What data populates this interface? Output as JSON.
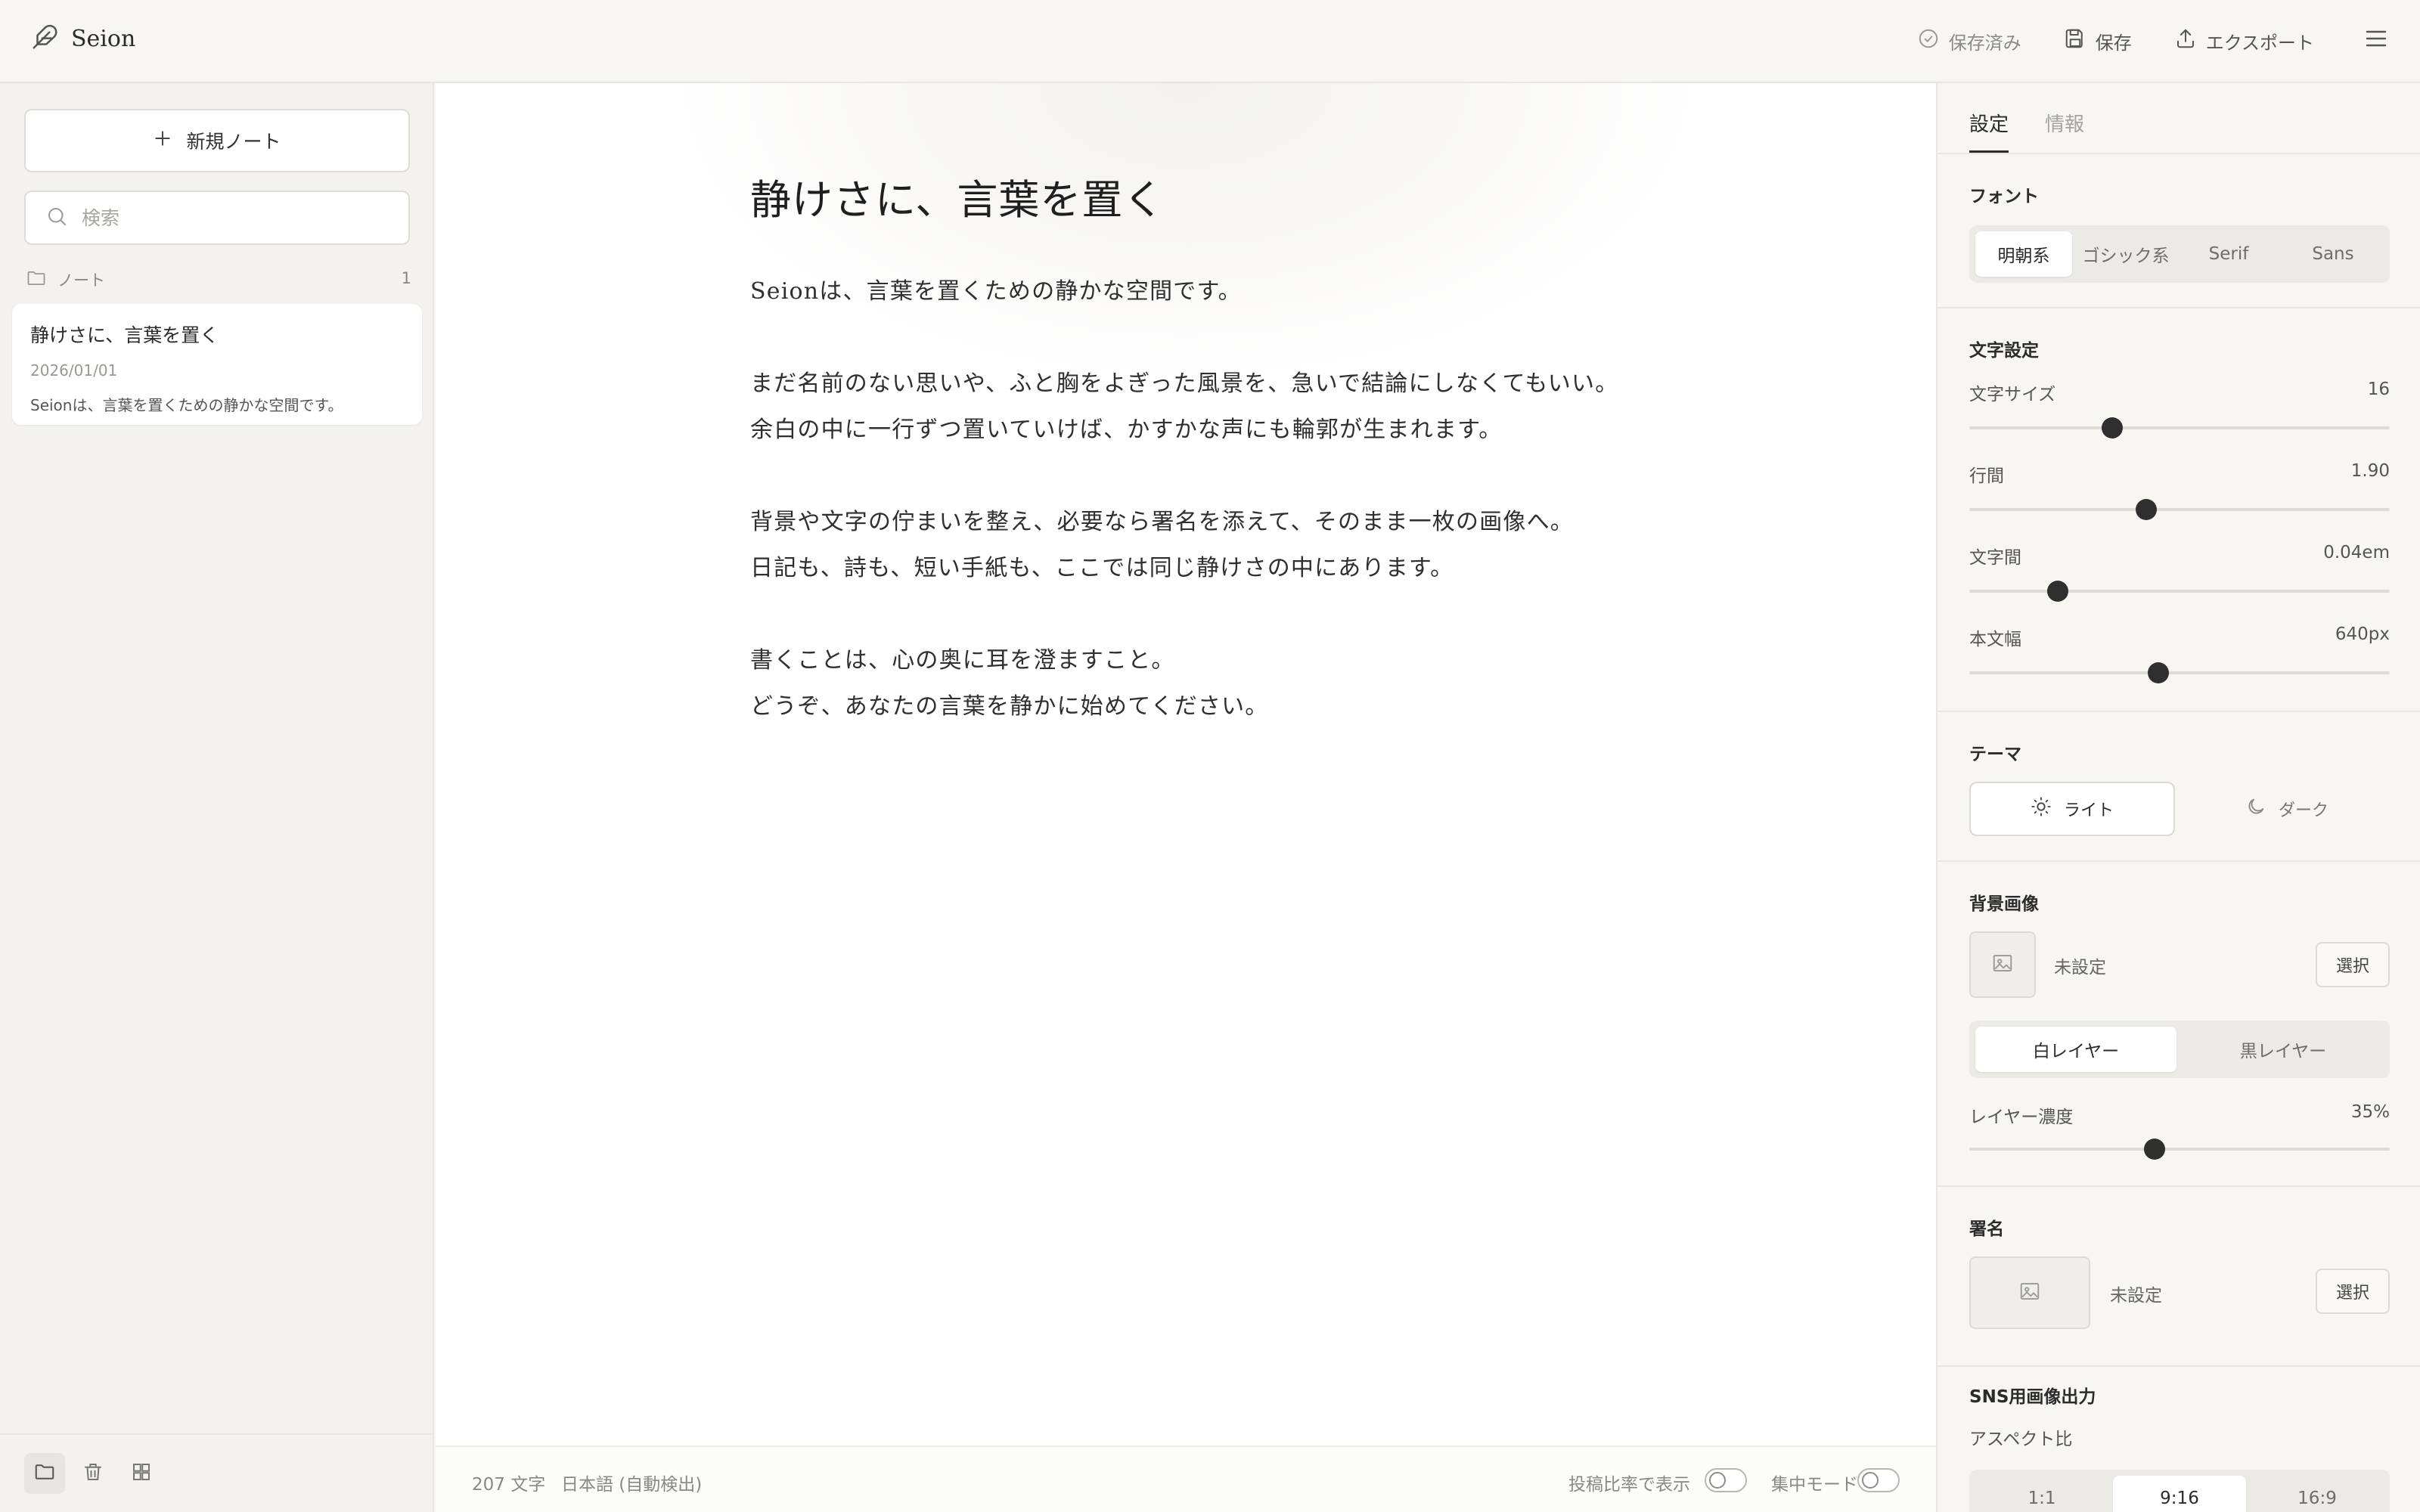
{
  "app": {
    "name": "Seion"
  },
  "header": {
    "saved_status": "保存済み",
    "save_label": "保存",
    "export_label": "エクスポート"
  },
  "sidebar": {
    "new_note_label": "新規ノート",
    "search_placeholder": "検索",
    "folder": {
      "name": "ノート",
      "count": "1"
    },
    "notes": [
      {
        "title": "静けさに、言葉を置く",
        "date": "2026/01/01",
        "excerpt": "Seionは、言葉を置くための静かな空間です。"
      }
    ]
  },
  "editor": {
    "title": "静けさに、言葉を置く",
    "paragraphs": [
      [
        "Seionは、言葉を置くための静かな空間です。"
      ],
      [
        "まだ名前のない思いや、ふと胸をよぎった風景を、急いで結論にしなくてもいい。",
        "余白の中に一行ずつ置いていけば、かすかな声にも輪郭が生まれます。"
      ],
      [
        "背景や文字の佇まいを整え、必要なら署名を添えて、そのまま一枚の画像へ。",
        "日記も、詩も、短い手紙も、ここでは同じ静けさの中にあります。"
      ],
      [
        "書くことは、心の奥に耳を澄ますこと。",
        "どうぞ、あなたの言葉を静かに始めてください。"
      ]
    ]
  },
  "status_bar": {
    "char_count": "207 文字",
    "language": "日本語 (自動検出)",
    "ratio_toggle_label": "投稿比率で表示",
    "focus_toggle_label": "集中モード",
    "ratio_toggle_on": false,
    "focus_toggle_on": false
  },
  "panel": {
    "tabs": [
      "設定",
      "情報"
    ],
    "active_tab": "設定",
    "font": {
      "title": "フォント",
      "options": [
        "明朝系",
        "ゴシック系",
        "Serif",
        "Sans"
      ],
      "selected": "明朝系"
    },
    "text_settings": {
      "title": "文字設定",
      "sliders": [
        {
          "label": "文字サイズ",
          "value": "16",
          "fraction": 0.34
        },
        {
          "label": "行間",
          "value": "1.90",
          "fraction": 0.42
        },
        {
          "label": "文字間",
          "value": "0.04em",
          "fraction": 0.21
        },
        {
          "label": "本文幅",
          "value": "640px",
          "fraction": 0.45
        }
      ]
    },
    "theme": {
      "title": "テーマ",
      "light_label": "ライト",
      "dark_label": "ダーク",
      "selected": "ライト"
    },
    "background": {
      "title": "背景画像",
      "status": "未設定",
      "select_label": "選択",
      "layers": [
        "白レイヤー",
        "黒レイヤー"
      ],
      "selected_layer": "白レイヤー",
      "opacity_label": "レイヤー濃度",
      "opacity_value": "35%",
      "opacity_fraction": 0.44
    },
    "signature": {
      "title": "署名",
      "status": "未設定",
      "select_label": "選択"
    },
    "sns": {
      "title": "SNS用画像出力",
      "aspect_label": "アスペクト比",
      "aspects": [
        "1:1",
        "9:16",
        "16:9"
      ],
      "selected": "9:16"
    }
  },
  "colors": {
    "accent": "#2f2f2f",
    "background": "#f7f6f3",
    "paper": "#ffffff"
  }
}
